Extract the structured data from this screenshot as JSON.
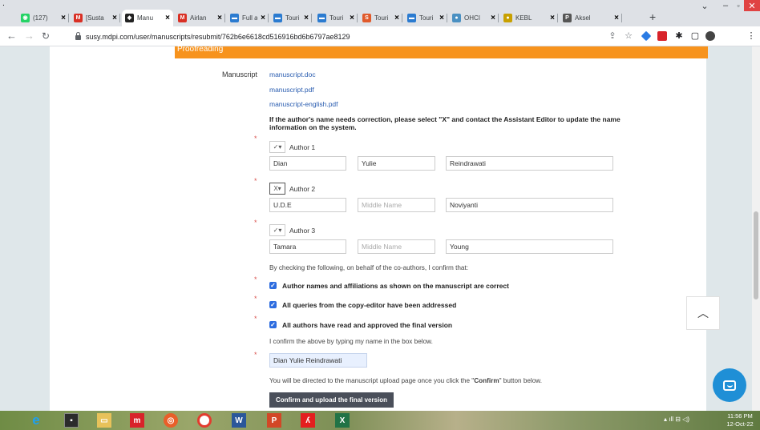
{
  "browser": {
    "tabs": [
      {
        "label": "(127)",
        "icon": "whatsapp-icon",
        "color": "#25d366",
        "glyph": "◉",
        "active": false
      },
      {
        "label": "[Susta",
        "icon": "gmail-icon",
        "color": "#d93025",
        "glyph": "M",
        "active": false
      },
      {
        "label": "Manu",
        "icon": "mdpi-icon",
        "color": "#222",
        "glyph": "◆",
        "active": true
      },
      {
        "label": "Airlan",
        "icon": "gmail-icon",
        "color": "#d93025",
        "glyph": "M",
        "active": false
      },
      {
        "label": "Full a",
        "icon": "elsevier-icon",
        "color": "#2b7bd0",
        "glyph": "▬",
        "active": false
      },
      {
        "label": "Touri",
        "icon": "elsevier-icon",
        "color": "#2b7bd0",
        "glyph": "▬",
        "active": false
      },
      {
        "label": "Touri",
        "icon": "elsevier-icon",
        "color": "#2b7bd0",
        "glyph": "▬",
        "active": false
      },
      {
        "label": "Touri",
        "icon": "sage-icon",
        "color": "#e05a2b",
        "glyph": "S",
        "active": false
      },
      {
        "label": "Touri",
        "icon": "elsevier-icon",
        "color": "#2b7bd0",
        "glyph": "▬",
        "active": false
      },
      {
        "label": "OHCI",
        "icon": "globe-icon",
        "color": "#4a90c2",
        "glyph": "●",
        "active": false
      },
      {
        "label": "KEBL",
        "icon": "kebl-icon",
        "color": "#c8a000",
        "glyph": "●",
        "active": false
      },
      {
        "label": "Aksel",
        "icon": "pdf-icon",
        "color": "#555",
        "glyph": "P",
        "active": false
      }
    ],
    "new_tab": "+",
    "url": "susy.mdpi.com/user/manuscripts/resubmit/762b6e6618cd516916bd6b6797ae8129"
  },
  "page": {
    "banner": "Proofreading",
    "manuscript_label": "Manuscript",
    "files": [
      "manuscript.doc",
      "manuscript.pdf",
      "manuscript-english.pdf"
    ],
    "notice": "If the author's name needs correction, please select \"X\" and contact the Assistant Editor to update the name information on the system.",
    "authors": [
      {
        "label": "Author 1",
        "mark": "✓▾",
        "first": "Dian",
        "middle": "Yulie",
        "middle_placeholder": "",
        "last": "Reindrawati"
      },
      {
        "label": "Author 2",
        "mark": "X▾",
        "first": "U.D.E",
        "middle": "",
        "middle_placeholder": "Middle Name",
        "last": "Noviyanti"
      },
      {
        "label": "Author 3",
        "mark": "✓▾",
        "first": "Tamara",
        "middle": "",
        "middle_placeholder": "Middle Name",
        "last": "Young"
      }
    ],
    "confirm_intro": "By checking the following, on behalf of the co-authors, I confirm that:",
    "checks": [
      "Author names and affiliations as shown on the manuscript are correct",
      "All queries from the copy-editor have been addressed",
      "All authors have read and approved the final version"
    ],
    "typing_prompt": "I confirm the above by typing my name in the box below.",
    "typed_name": "Dian Yulie Reindrawati",
    "redirect_note_pre": "You will be directed to the manuscript upload page once you click the \"",
    "redirect_note_bold": "Confirm",
    "redirect_note_post": "\" button below.",
    "confirm_button": "Confirm and upload the final version",
    "required_mark": "*"
  },
  "taskbar": {
    "time": "11:56 PM",
    "date": "12-Oct-22"
  }
}
